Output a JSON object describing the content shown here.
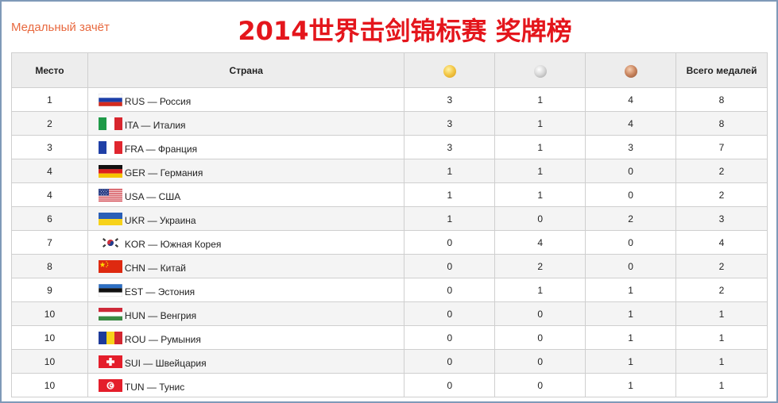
{
  "caption": "Медальный зачёт",
  "title": "2014世界击剑锦标赛 奖牌榜",
  "table": {
    "headers": {
      "place": "Место",
      "country": "Страна",
      "gold_icon": "gold-medal-icon",
      "silver_icon": "silver-medal-icon",
      "bronze_icon": "bronze-medal-icon",
      "total": "Всего медалей"
    },
    "rows": [
      {
        "place": "1",
        "country": "RUS — Россия",
        "flag": "russia-flag-icon",
        "gold": "3",
        "silver": "1",
        "bronze": "4",
        "total": "8"
      },
      {
        "place": "2",
        "country": "ITA — Италия",
        "flag": "italy-flag-icon",
        "gold": "3",
        "silver": "1",
        "bronze": "4",
        "total": "8"
      },
      {
        "place": "3",
        "country": "FRA — Франция",
        "flag": "france-flag-icon",
        "gold": "3",
        "silver": "1",
        "bronze": "3",
        "total": "7"
      },
      {
        "place": "4",
        "country": "GER — Германия",
        "flag": "germany-flag-icon",
        "gold": "1",
        "silver": "1",
        "bronze": "0",
        "total": "2"
      },
      {
        "place": "4",
        "country": "USA — США",
        "flag": "usa-flag-icon",
        "gold": "1",
        "silver": "1",
        "bronze": "0",
        "total": "2"
      },
      {
        "place": "6",
        "country": "UKR — Украина",
        "flag": "ukraine-flag-icon",
        "gold": "1",
        "silver": "0",
        "bronze": "2",
        "total": "3"
      },
      {
        "place": "7",
        "country": "KOR — Южная Корея",
        "flag": "south-korea-flag-icon",
        "gold": "0",
        "silver": "4",
        "bronze": "0",
        "total": "4"
      },
      {
        "place": "8",
        "country": "CHN — Китай",
        "flag": "china-flag-icon",
        "gold": "0",
        "silver": "2",
        "bronze": "0",
        "total": "2"
      },
      {
        "place": "9",
        "country": "EST — Эстония",
        "flag": "estonia-flag-icon",
        "gold": "0",
        "silver": "1",
        "bronze": "1",
        "total": "2"
      },
      {
        "place": "10",
        "country": "HUN — Венгрия",
        "flag": "hungary-flag-icon",
        "gold": "0",
        "silver": "0",
        "bronze": "1",
        "total": "1"
      },
      {
        "place": "10",
        "country": "ROU — Румыния",
        "flag": "romania-flag-icon",
        "gold": "0",
        "silver": "0",
        "bronze": "1",
        "total": "1"
      },
      {
        "place": "10",
        "country": "SUI — Швейцария",
        "flag": "switzerland-flag-icon",
        "gold": "0",
        "silver": "0",
        "bronze": "1",
        "total": "1"
      },
      {
        "place": "10",
        "country": "TUN — Тунис",
        "flag": "tunisia-flag-icon",
        "gold": "0",
        "silver": "0",
        "bronze": "1",
        "total": "1"
      }
    ]
  },
  "colors": {
    "title": "#e4161c",
    "caption": "#e8693f",
    "header_bg": "#ededed",
    "border": "#cfcfcf",
    "frame": "#7f99b8"
  }
}
